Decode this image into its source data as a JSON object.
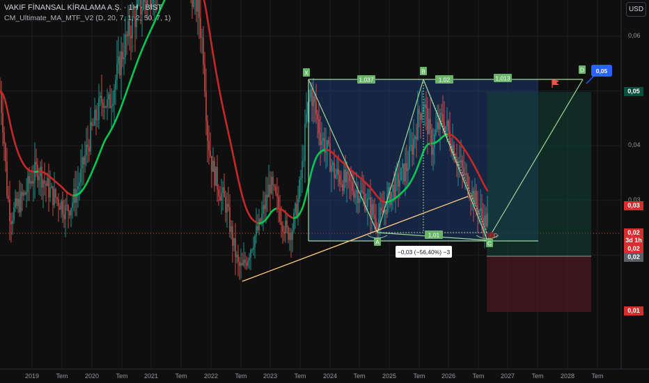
{
  "header": {
    "title": "VAKIF FİNANSAL KİRALAMA A.Ş. · 1H · BIST",
    "indicator": "CM_Ultimate_MA_MTF_V2 (D, 20, 7, 1, 2, 50, 7, 1)"
  },
  "currency_button": "USD",
  "price_labels": [
    {
      "text": "0,05",
      "bg": "#0b4f3e",
      "color": "#ffffff"
    },
    {
      "text": "0,03",
      "bg": "#d32f2f",
      "color": "#ffffff"
    },
    {
      "text": "0,02",
      "bg": "#d32f2f",
      "color": "#ffffff"
    },
    {
      "text": "3d 1h",
      "bg": "#d32f2f",
      "color": "#ffffff"
    },
    {
      "text": "0,02",
      "bg": "#d32f2f",
      "color": "#ffffff"
    },
    {
      "text": "0,02",
      "bg": "#5b5e66",
      "color": "#ffffff"
    },
    {
      "text": "0,01",
      "bg": "#d32f2f",
      "color": "#ffffff"
    }
  ],
  "chart_data": {
    "type": "candlestick",
    "x_ticks": [
      "2019",
      "Tem",
      "2020",
      "Tem",
      "2021",
      "Tem",
      "2022",
      "Tem",
      "2023",
      "Tem",
      "2024",
      "Tem",
      "2025",
      "Tem",
      "2026",
      "Tem",
      "2027",
      "Tem",
      "2028",
      "Tem"
    ],
    "y_ticks": [
      "0,06",
      "0,05",
      "0,04",
      "0,03",
      "0,02"
    ],
    "pattern_points": [
      {
        "label": "X",
        "value": 0.0525
      },
      {
        "label": "A",
        "value": 0.0255
      },
      {
        "label": "B",
        "value": 0.0525
      },
      {
        "label": "C",
        "value": 0.025
      },
      {
        "label": "D",
        "value": 0.0525
      }
    ],
    "pattern_ratios": [
      "1,037",
      "1,02",
      "1,013",
      "1,01"
    ],
    "target_label": "0,05",
    "measurement": "−0,03 (−56,40%) −3",
    "colors": {
      "up": "#26a69a",
      "down": "#ef5350",
      "ma_up": "#00c853",
      "ma_down": "#c62828",
      "pattern": "#9fd99a",
      "trend": "#ffcc80"
    }
  }
}
